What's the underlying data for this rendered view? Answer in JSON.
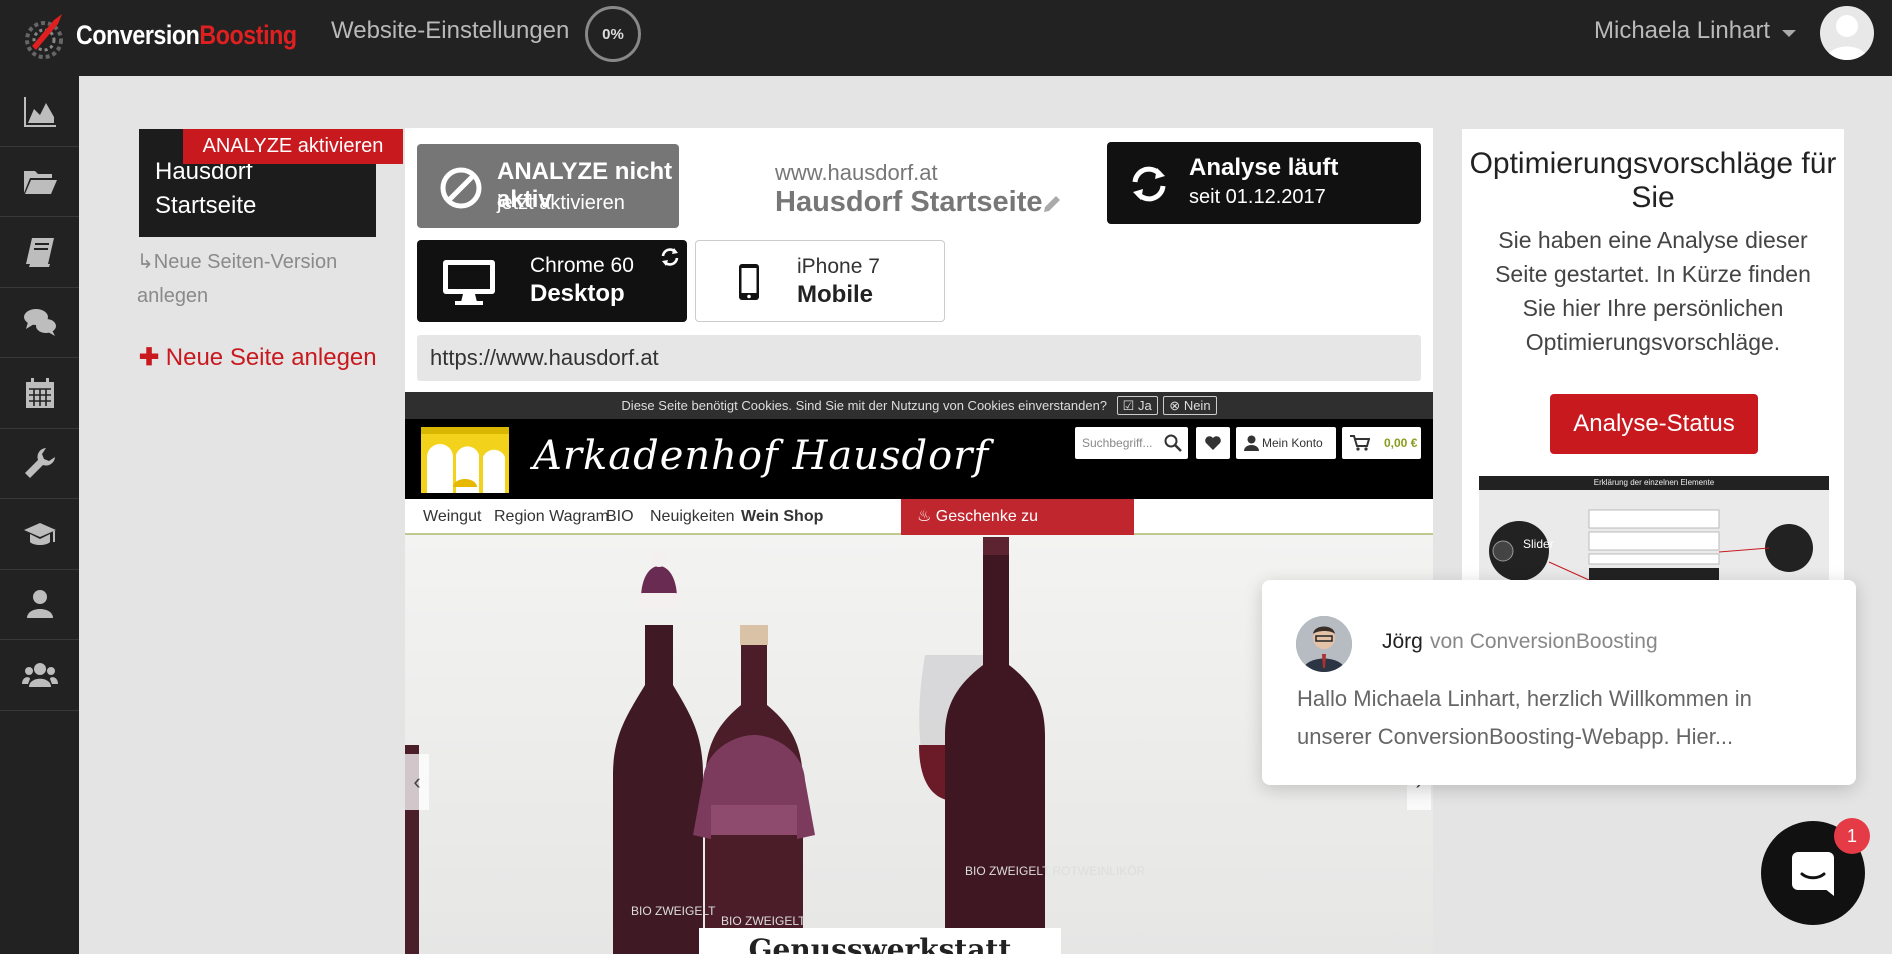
{
  "topbar": {
    "brand_part1": "Conversion",
    "brand_part2": "Boosting",
    "brand_colors": {
      "primary": "#ffffff",
      "accent": "#e02020"
    },
    "site_settings_label": "Website-Einstellungen",
    "progress_value": 0,
    "progress_label": "0%",
    "user_name": "Michaela Linhart"
  },
  "sidenav": {
    "items": [
      {
        "icon": "chart-area-icon"
      },
      {
        "icon": "folder-open-icon"
      },
      {
        "icon": "book-icon"
      },
      {
        "icon": "comments-icon"
      },
      {
        "icon": "calendar-icon"
      },
      {
        "icon": "wrench-icon"
      },
      {
        "icon": "graduation-cap-icon"
      },
      {
        "icon": "user-icon"
      },
      {
        "icon": "users-icon"
      }
    ]
  },
  "left": {
    "page_card_title": "Hausdorf Startseite",
    "analyze_ribbon": "ANALYZE aktivieren",
    "new_version": "↳Neue Seiten-Version anlegen",
    "new_page": "Neue Seite anlegen"
  },
  "center": {
    "analyze_status_title": "ANALYZE nicht aktiv",
    "analyze_status_sub": "jetzt aktivieren",
    "site_domain": "www.hausdorf.at",
    "site_title": "Hausdorf Startseite",
    "analysis_title": "Analyse läuft",
    "analysis_since": "seit 01.12.2017",
    "devices": [
      {
        "browser": "Chrome 60",
        "type": "Desktop",
        "selected": true
      },
      {
        "browser": "iPhone 7",
        "type": "Mobile",
        "selected": false
      }
    ],
    "url": "https://www.hausdorf.at"
  },
  "embedded_site": {
    "cookie_text": "Diese Seite benötigt Cookies. Sind Sie mit der Nutzung von Cookies einverstanden?",
    "cookie_yes": "Ja",
    "cookie_no": "Nein",
    "logo_text": "Arkadenhof Hausdorf",
    "search_placeholder": "Suchbegriff...",
    "account_label": "Mein Konto",
    "cart_total": "0,00 €",
    "nav": [
      "Weingut",
      "Region Wagram",
      "BIO",
      "Neuigkeiten",
      "Wein Shop"
    ],
    "nav_gift": "♨ Geschenke zu Weihnachten",
    "hero_caption": "Genusswerkstatt",
    "bottle_labels": [
      "BIO ZWEIGELT",
      "BIO ZWEIGELT",
      "BIO ZWEIGELT ROTWEINLIKÖR"
    ],
    "prev_arrow": "‹",
    "next_arrow": "›"
  },
  "right_panel": {
    "title": "Optimierungsvorschläge für Sie",
    "text": "Sie haben eine Analyse dieser Seite gestartet. In Kürze finden Sie hier Ihre persönlichen Optimierungsvorschläge.",
    "button": "Analyse-Status",
    "preview_header": "Erklärung der einzelnen Elemente",
    "preview_slider": "Slider"
  },
  "chat": {
    "sender": "Jörg",
    "from": "von ConversionBoosting",
    "message": "Hallo Michaela Linhart, herzlich Willkommen in unserer ConversionBoosting-Webapp. Hier...",
    "badge_count": "1"
  }
}
